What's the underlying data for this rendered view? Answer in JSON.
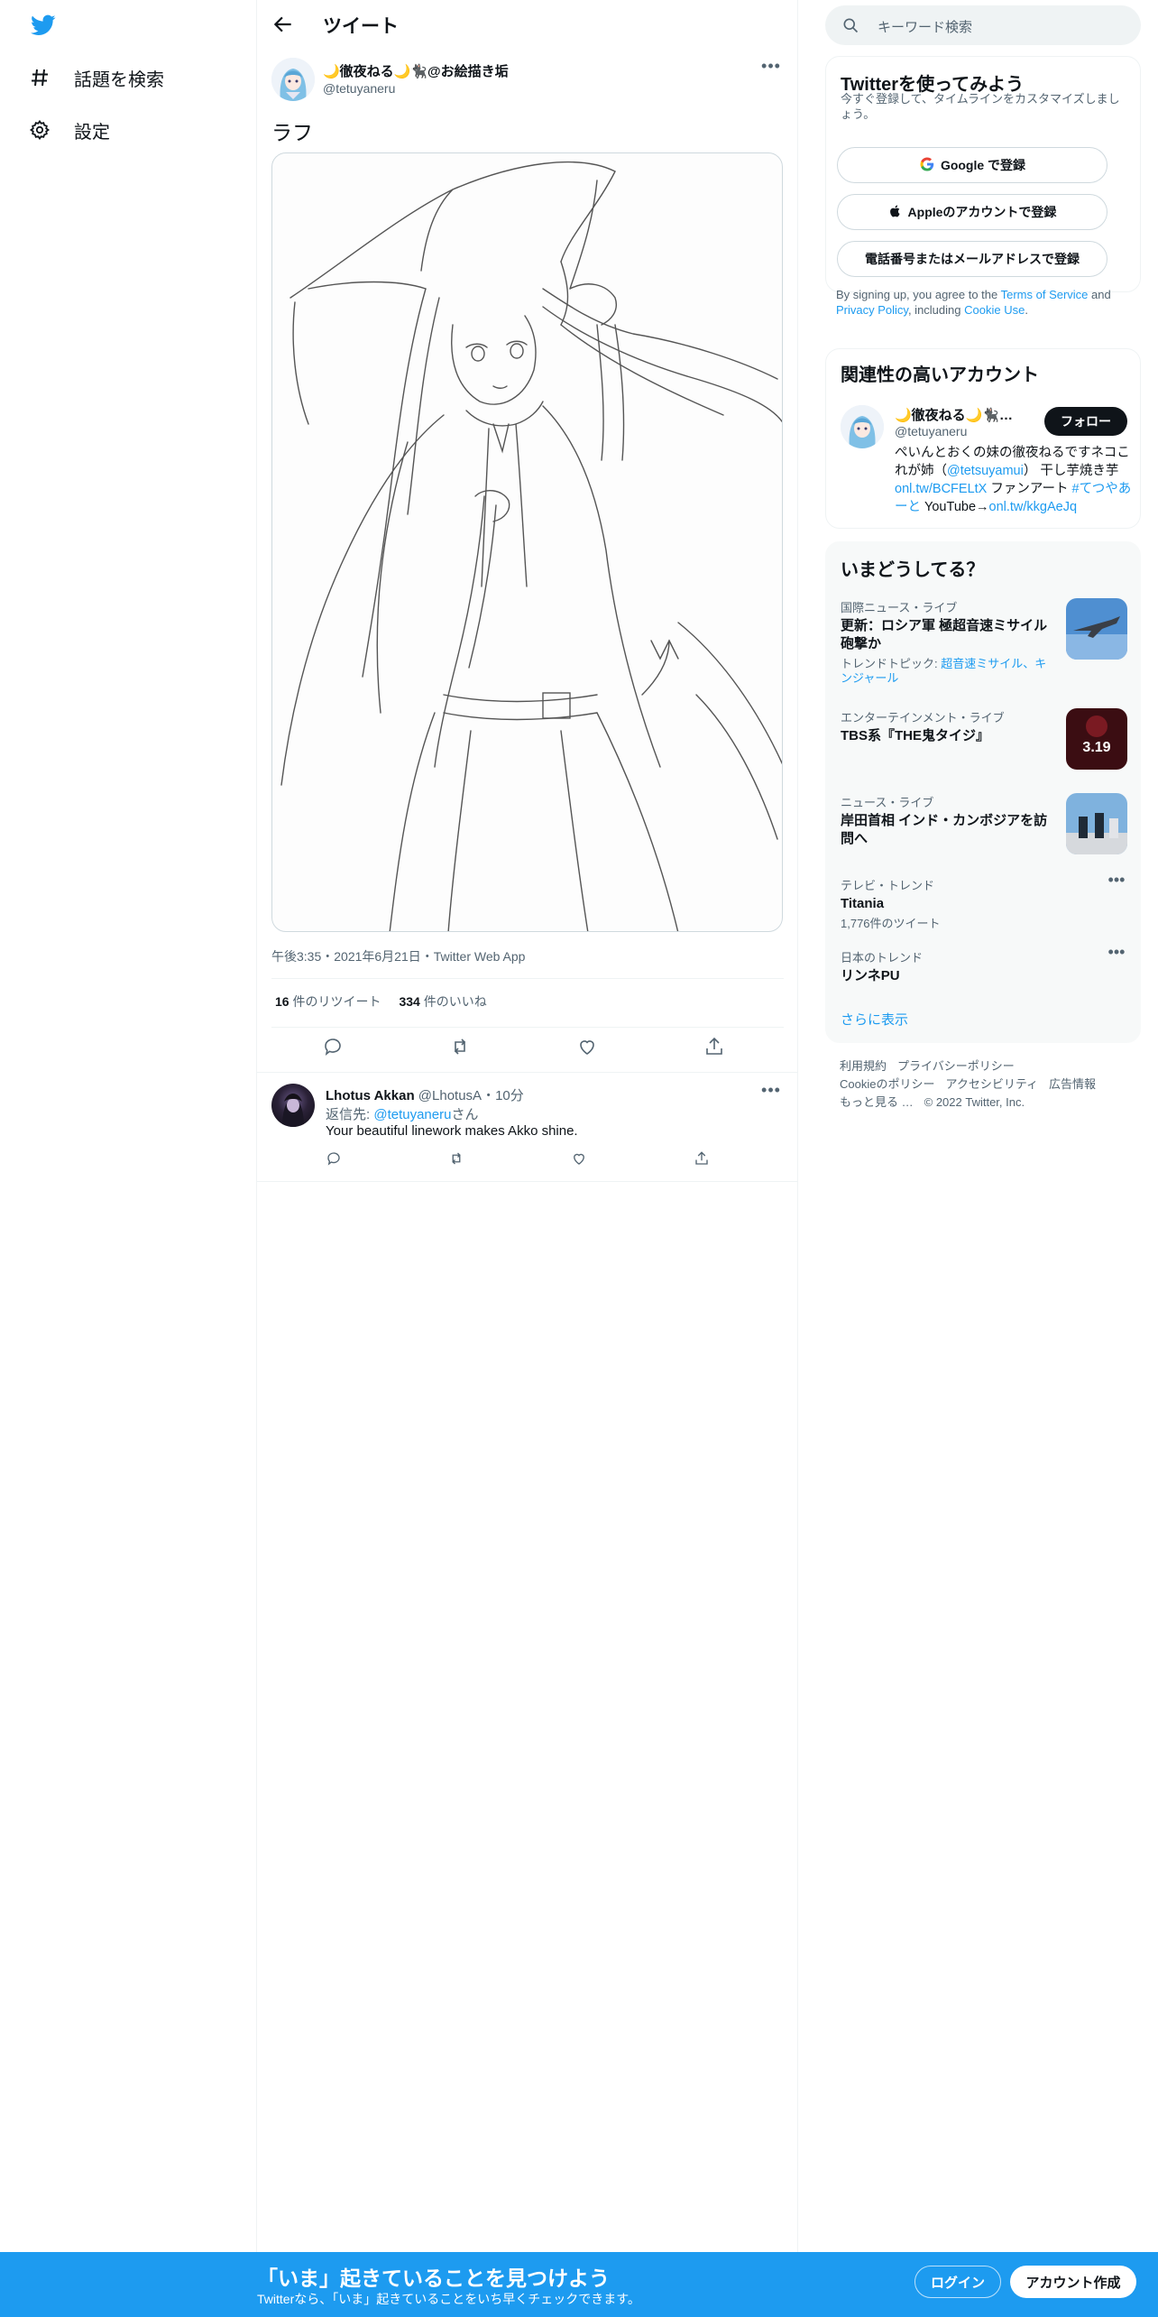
{
  "nav": {
    "items": [
      {
        "label": "話題を検索",
        "icon": "hashtag-icon"
      },
      {
        "label": "設定",
        "icon": "gear-icon"
      }
    ]
  },
  "header": {
    "title": "ツイート"
  },
  "tweet": {
    "author_name": "🌙徹夜ねる🌙🐈‍⬛@お絵描き垢",
    "author_handle": "@tetuyaneru",
    "text": "ラフ",
    "media_description": "witch girl line sketch",
    "timestamp": "午後3:35・2021年6月21日・Twitter Web App",
    "retweets_count": "16",
    "retweets_label": " 件のリツイート",
    "likes_count": "334",
    "likes_label": " 件のいいね"
  },
  "reply": {
    "name": "Lhotus Akkan",
    "handle_time": "@LhotusA・10分",
    "reply_prefix": "返信先: ",
    "reply_mention": "@tetuyaneru",
    "reply_suffix": "さん",
    "text": "Your beautiful linework makes Akko shine."
  },
  "search": {
    "placeholder": "キーワード検索"
  },
  "signup": {
    "title": "Twitterを使ってみよう",
    "desc": "今すぐ登録して、タイムラインをカスタマイズしましょう。",
    "google": "Google で登録",
    "apple": "Appleのアカウントで登録",
    "phone": "電話番号またはメールアドレスで登録",
    "terms_1": "By signing up, you agree to the ",
    "terms_tos": "Terms of Service",
    "terms_2": " and ",
    "terms_pp": "Privacy Policy",
    "terms_3": ", including ",
    "terms_cookie": "Cookie Use",
    "terms_4": "."
  },
  "related": {
    "title": "関連性の高いアカウント",
    "name": "🌙徹夜ねる🌙🐈‍⬛@お絵描き垢",
    "handle": "@tetuyaneru",
    "follow": "フォロー",
    "bio_1": "ぺいんとおくの妹の徹夜ねるですネコこれが姉（",
    "bio_mention": "@tetsuyamui",
    "bio_2": "） 干し芋焼き芋",
    "bio_link1": "onl.tw/BCFELtX",
    "bio_3": " ファンアート ",
    "bio_tag": "#てつやあーと",
    "bio_4": " YouTube→",
    "bio_link2": "onl.tw/kkgAeJq"
  },
  "trends": {
    "title": "いまどうしてる？",
    "items": [
      {
        "category": "国際ニュース・ライブ",
        "title": "更新：ロシア軍 極超音速ミサイル砲撃か",
        "sub_prefix": "トレンドトピック: ",
        "sub_links": "超音速ミサイル、キンジャール"
      },
      {
        "category": "エンターテインメント・ライブ",
        "title": "TBS系『THE鬼タイジ』",
        "thumb_text": "3.19"
      },
      {
        "category": "ニュース・ライブ",
        "title": "岸田首相 インド・カンボジアを訪問へ"
      },
      {
        "category": "テレビ・トレンド",
        "title": "Titania",
        "sub": "1,776件のツイート"
      },
      {
        "category": "日本のトレンド",
        "title": "リンネPU"
      }
    ],
    "show_more": "さらに表示"
  },
  "footer": {
    "links": [
      "利用規約",
      "プライバシーポリシー",
      "Cookieのポリシー",
      "アクセシビリティ",
      "広告情報",
      "もっと見る …"
    ],
    "copyright": "© 2022 Twitter, Inc."
  },
  "bottombar": {
    "title": "「いま」起きていることを見つけよう",
    "sub": "Twitterなら、「いま」起きていることをいち早くチェックできます。",
    "login": "ログイン",
    "signup": "アカウント作成"
  },
  "colors": {
    "accent": "#1d9bf0",
    "text": "#0f1419",
    "muted": "#536471",
    "border": "#eff3f4"
  }
}
